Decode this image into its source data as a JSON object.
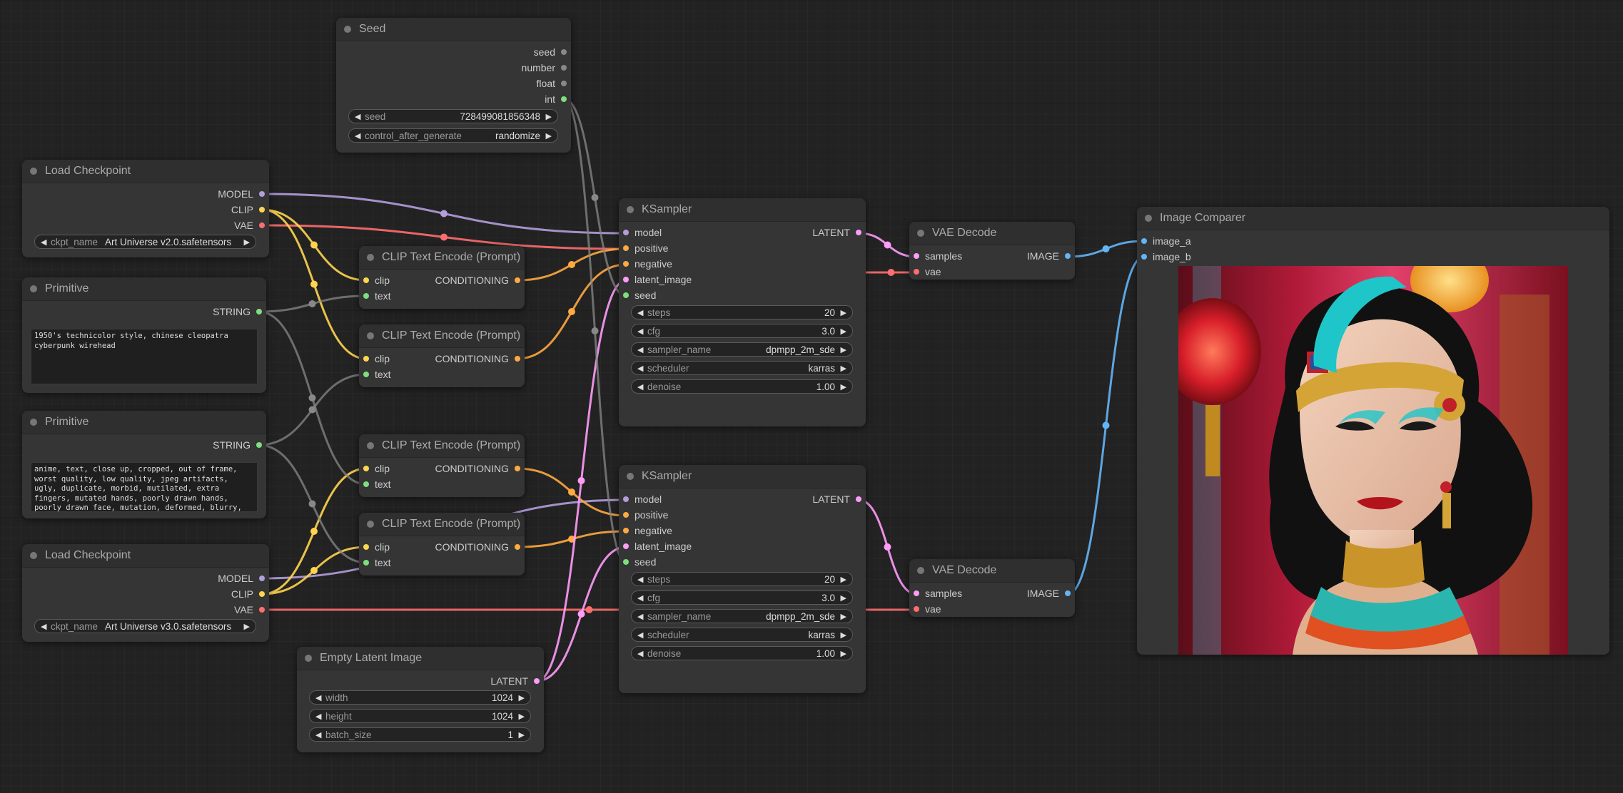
{
  "colors": {
    "model": "#b39ddb",
    "clip": "#ffd54f",
    "vae": "#ff6e6e",
    "conditioning": "#ffa940",
    "latent": "#ff9cf9",
    "image": "#64b5f6",
    "string": "#7ddf7d",
    "int": "#7ddf7d",
    "seed": "#7ddf7d",
    "neutral": "#888888"
  },
  "seed": {
    "title": "Seed",
    "outputs": [
      "seed",
      "number",
      "float",
      "int"
    ],
    "seed_label": "seed",
    "seed_value": "728499081856348",
    "cag_label": "control_after_generate",
    "cag_value": "randomize"
  },
  "ckpt1": {
    "title": "Load Checkpoint",
    "outputs": [
      "MODEL",
      "CLIP",
      "VAE"
    ],
    "ckpt_label": "ckpt_name",
    "ckpt_value": "Art Universe v2.0.safetensors"
  },
  "prim1": {
    "title": "Primitive",
    "output": "STRING",
    "text": "1950's technicolor style, chinese cleopatra cyberpunk wirehead"
  },
  "prim2": {
    "title": "Primitive",
    "output": "STRING",
    "text": "anime, text, close up, cropped, out of frame, worst quality, low quality, jpeg artifacts, ugly, duplicate, morbid, mutilated, extra fingers, mutated hands, poorly drawn hands, poorly drawn face, mutation, deformed, blurry, dehydrated, bad anatomy, bad proportions, extra"
  },
  "ckpt2": {
    "title": "Load Checkpoint",
    "outputs": [
      "MODEL",
      "CLIP",
      "VAE"
    ],
    "ckpt_label": "ckpt_name",
    "ckpt_value": "Art Universe v3.0.safetensors"
  },
  "clip": {
    "title": "CLIP Text Encode (Prompt)",
    "in_clip": "clip",
    "in_text": "text",
    "output": "CONDITIONING"
  },
  "ks": {
    "title": "KSampler",
    "inputs": [
      "model",
      "positive",
      "negative",
      "latent_image",
      "seed"
    ],
    "output": "LATENT",
    "widgets": [
      {
        "label": "steps",
        "value": "20"
      },
      {
        "label": "cfg",
        "value": "3.0"
      },
      {
        "label": "sampler_name",
        "value": "dpmpp_2m_sde"
      },
      {
        "label": "scheduler",
        "value": "karras"
      },
      {
        "label": "denoise",
        "value": "1.00"
      }
    ]
  },
  "vaedec": {
    "title": "VAE Decode",
    "in_samples": "samples",
    "in_vae": "vae",
    "output": "IMAGE"
  },
  "comparer": {
    "title": "Image Comparer",
    "inputs": [
      "image_a",
      "image_b"
    ]
  },
  "latent": {
    "title": "Empty Latent Image",
    "output": "LATENT",
    "widgets": [
      {
        "label": "width",
        "value": "1024"
      },
      {
        "label": "height",
        "value": "1024"
      },
      {
        "label": "batch_size",
        "value": "1"
      }
    ]
  }
}
